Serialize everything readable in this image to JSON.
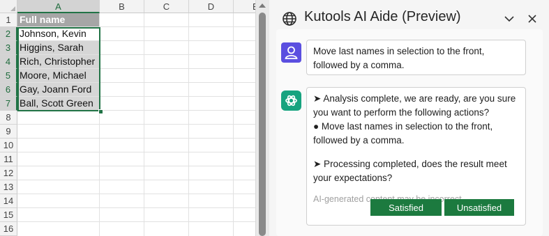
{
  "spreadsheet": {
    "columns": [
      "A",
      "B",
      "C",
      "D",
      "E"
    ],
    "rows": [
      "1",
      "2",
      "3",
      "4",
      "5",
      "6",
      "7",
      "8",
      "9",
      "10",
      "11",
      "12",
      "13",
      "14",
      "15",
      "16"
    ],
    "cells_a": [
      "Full name",
      "Johnson, Kevin",
      "Higgins, Sarah",
      "Rich, Christopher",
      "Moore, Michael",
      "Gay, Joann Ford",
      "Ball, Scott Green"
    ],
    "selection_color": "#217346"
  },
  "pane": {
    "title": "Kutools AI Aide (Preview)",
    "icons": {
      "title": "globe-icon",
      "collapse": "chevron-down-icon",
      "close": "close-icon"
    },
    "user_message": "Move last names in selection to the front, followed by a comma.",
    "bot_message": {
      "line1": "➤ Analysis complete, we are ready, are you sure you want to perform the following actions?",
      "line2": "● Move last names in selection to the front, followed by a comma.",
      "line3": "➤ Processing completed, does the result meet your expectations?"
    },
    "ai_note": "AI-generated content may be incorrect",
    "buttons": {
      "satisfied": "Satisfied",
      "unsatisfied": "Unsatisfied"
    },
    "colors": {
      "button": "#1c7a3f",
      "user_avatar": "#5b4fe0",
      "bot_avatar": "#17a37f"
    }
  }
}
